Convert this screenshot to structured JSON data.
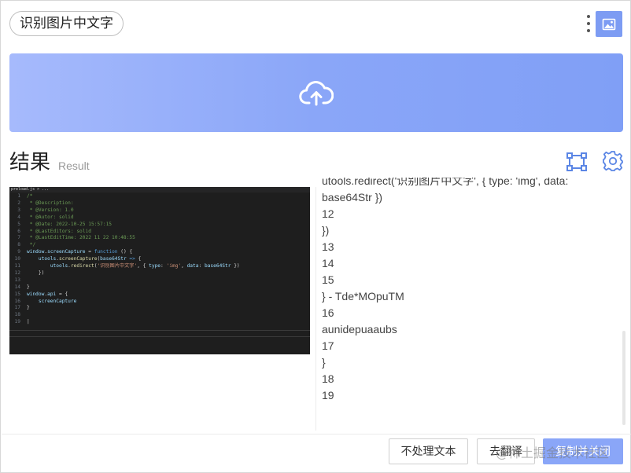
{
  "header": {
    "title": "识别图片中文字",
    "more_icon": "vertical-dots-icon",
    "image_icon": "image-icon"
  },
  "upload": {
    "icon": "cloud-upload-icon",
    "gradient_colors": [
      "#a6bafc",
      "#809ff6"
    ]
  },
  "result": {
    "title": "结果",
    "subtitle": "Result",
    "crop_icon": "crop-frame-icon",
    "settings_icon": "gear-icon",
    "accent_color": "#5b86e5"
  },
  "preview": {
    "tab_label": "preload.js > ...",
    "lines": [
      {
        "num": "1",
        "segments": [
          {
            "c": "cm",
            "t": "/*"
          }
        ]
      },
      {
        "num": "2",
        "segments": [
          {
            "c": "cm",
            "t": " * @Description:"
          }
        ]
      },
      {
        "num": "3",
        "segments": [
          {
            "c": "cm",
            "t": " * @Version: 1.0"
          }
        ]
      },
      {
        "num": "4",
        "segments": [
          {
            "c": "cm",
            "t": " * @Autor: solid"
          }
        ]
      },
      {
        "num": "5",
        "segments": [
          {
            "c": "cm",
            "t": " * @Date: 2022-10-25 15:57:15"
          }
        ]
      },
      {
        "num": "6",
        "segments": [
          {
            "c": "cm",
            "t": " * @LastEditors: solid"
          }
        ]
      },
      {
        "num": "7",
        "segments": [
          {
            "c": "cm",
            "t": " * @LastEditTime: 2022 11 22 10:48:55"
          }
        ]
      },
      {
        "num": "8",
        "segments": [
          {
            "c": "cm",
            "t": " */"
          }
        ]
      },
      {
        "num": "9",
        "segments": [
          {
            "c": "id",
            "t": "window"
          },
          {
            "c": "pu",
            "t": "."
          },
          {
            "c": "id",
            "t": "screenCapture"
          },
          {
            "c": "pu",
            "t": " = "
          },
          {
            "c": "kw",
            "t": "function"
          },
          {
            "c": "pu",
            "t": " () {"
          }
        ]
      },
      {
        "num": "10",
        "segments": [
          {
            "c": "pu",
            "t": "    "
          },
          {
            "c": "id",
            "t": "utools"
          },
          {
            "c": "pu",
            "t": "."
          },
          {
            "c": "fn",
            "t": "screenCapture"
          },
          {
            "c": "pu",
            "t": "("
          },
          {
            "c": "id",
            "t": "base64Str"
          },
          {
            "c": "kw",
            "t": " => "
          },
          {
            "c": "pu",
            "t": "{"
          }
        ]
      },
      {
        "num": "11",
        "segments": [
          {
            "c": "pu",
            "t": "        "
          },
          {
            "c": "id",
            "t": "utools"
          },
          {
            "c": "pu",
            "t": "."
          },
          {
            "c": "fn",
            "t": "redirect"
          },
          {
            "c": "pu",
            "t": "("
          },
          {
            "c": "st",
            "t": "'识别图片中文字'"
          },
          {
            "c": "pu",
            "t": ", { "
          },
          {
            "c": "id",
            "t": "type"
          },
          {
            "c": "pu",
            "t": ": "
          },
          {
            "c": "st",
            "t": "'img'"
          },
          {
            "c": "pu",
            "t": ", "
          },
          {
            "c": "id",
            "t": "data"
          },
          {
            "c": "pu",
            "t": ": "
          },
          {
            "c": "id",
            "t": "base64Str"
          },
          {
            "c": "pu",
            "t": " })"
          }
        ]
      },
      {
        "num": "12",
        "segments": [
          {
            "c": "pu",
            "t": "    })"
          }
        ]
      },
      {
        "num": "13",
        "segments": []
      },
      {
        "num": "14",
        "segments": [
          {
            "c": "pu",
            "t": "}"
          }
        ]
      },
      {
        "num": "15",
        "segments": [
          {
            "c": "id",
            "t": "window"
          },
          {
            "c": "pu",
            "t": "."
          },
          {
            "c": "id",
            "t": "api"
          },
          {
            "c": "pu",
            "t": " = {"
          }
        ]
      },
      {
        "num": "16",
        "segments": [
          {
            "c": "pu",
            "t": "    "
          },
          {
            "c": "id",
            "t": "screenCapture"
          }
        ]
      },
      {
        "num": "17",
        "segments": [
          {
            "c": "pu",
            "t": "}"
          }
        ]
      },
      {
        "num": "18",
        "segments": []
      },
      {
        "num": "19",
        "segments": [
          {
            "c": "pu",
            "t": "|"
          }
        ]
      }
    ]
  },
  "ocr_text": [
    "utools.redirect('识别图片中文字', { type: 'img', data:",
    "base64Str })",
    "12",
    "})",
    "13",
    "14",
    "15",
    "} - Tde*MOpuTM",
    "16",
    "aunidepuaaubs",
    "17",
    "}",
    "18",
    "19"
  ],
  "footer": {
    "no_process_label": "不处理文本",
    "translate_label": "去翻译",
    "copy_label": "复制并关闭",
    "copy_color": "#8aa6f8"
  },
  "watermark": "@稀土掘金技术社区"
}
